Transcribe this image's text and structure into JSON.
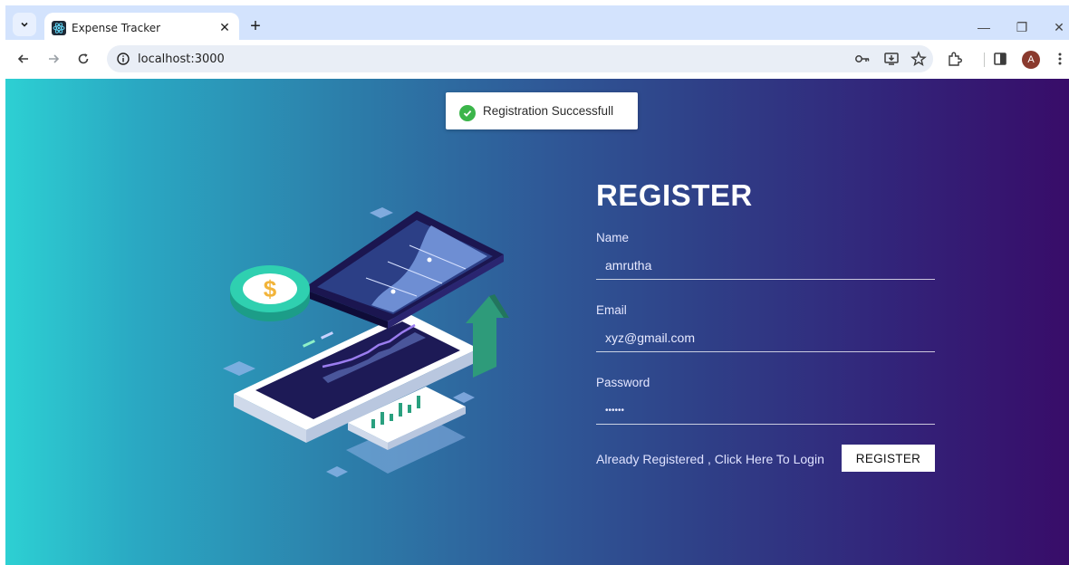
{
  "browser": {
    "tab_title": "Expense Tracker",
    "tab_close": "✕",
    "new_tab": "+",
    "url": "localhost:3000",
    "window_minimize": "—",
    "window_restore": "❐",
    "window_close": "✕",
    "profile_initial": "A"
  },
  "toast": {
    "message": "Registration Successfull",
    "status_color": "#3bb54a"
  },
  "form": {
    "title": "REGISTER",
    "name_label": "Name",
    "name_value": "amrutha",
    "email_label": "Email",
    "email_value": "xyz@gmail.com",
    "password_label": "Password",
    "password_value": "••••••",
    "login_link": "Already Registered , Click Here To Login",
    "register_button": "REGISTER"
  },
  "illustration": {
    "coin_symbol": "$"
  },
  "colors": {
    "gradient_start": "#2dd0d3",
    "gradient_end": "#380c69",
    "tabbar": "#d3e3fd"
  }
}
